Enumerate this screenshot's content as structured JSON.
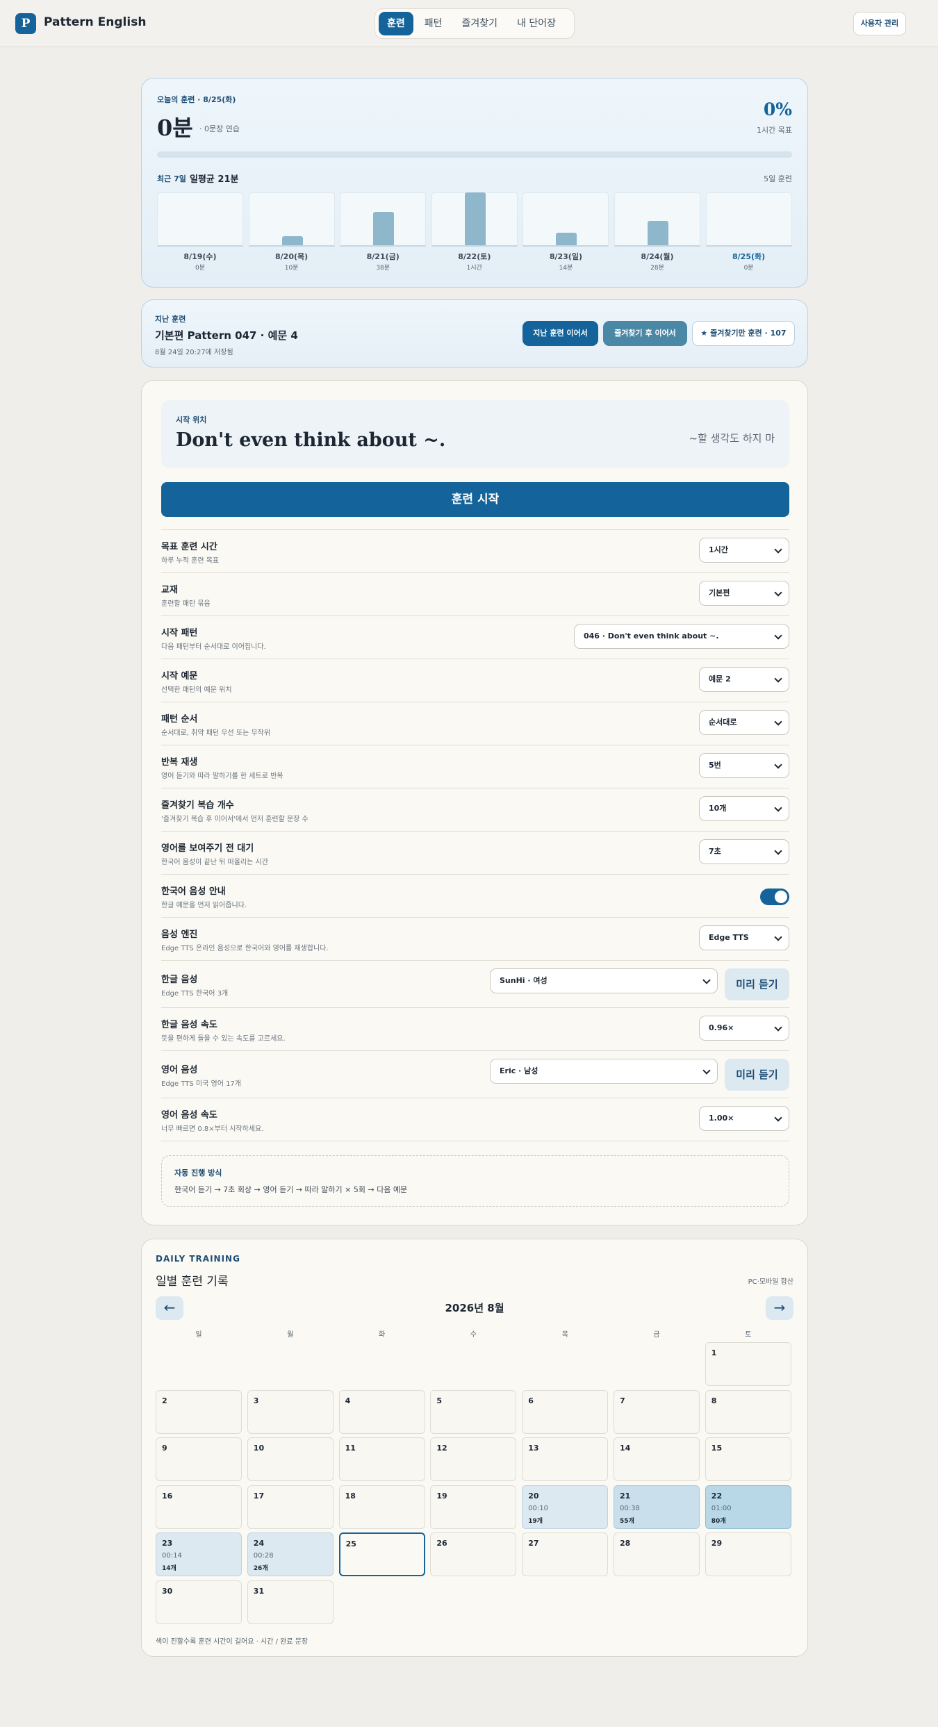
{
  "app": {
    "logo_letter": "P",
    "name": "Pattern English",
    "admin_label": "사용자 관리"
  },
  "nav": {
    "tabs": [
      "훈련",
      "패턴",
      "즐겨찾기",
      "내 단어장"
    ],
    "active_index": 0
  },
  "today": {
    "kicker": "오늘의 훈련 · 8/25(화)",
    "minutes": "0분",
    "sentences": "· 0문장 연습",
    "percent": "0%",
    "goal": "1시간 목표",
    "progress": 0,
    "week_label": "최근 7일",
    "week_avg": "일평균 21분",
    "week_days": "5일 훈련",
    "days": [
      {
        "date": "8/19(수)",
        "value": "0분",
        "minutes": 0
      },
      {
        "date": "8/20(목)",
        "value": "10분",
        "minutes": 10
      },
      {
        "date": "8/21(금)",
        "value": "38분",
        "minutes": 38
      },
      {
        "date": "8/22(토)",
        "value": "1시간",
        "minutes": 60
      },
      {
        "date": "8/23(일)",
        "value": "14분",
        "minutes": 14
      },
      {
        "date": "8/24(월)",
        "value": "28분",
        "minutes": 28
      },
      {
        "date": "8/25(화)",
        "value": "0분",
        "minutes": 0
      }
    ]
  },
  "resume": {
    "kicker": "지난 훈련",
    "title": "기본편 Pattern 047 · 예문 4",
    "saved": "8월 24일 20:27에 저장됨",
    "btn_continue": "지난 훈련 이어서",
    "btn_fav_continue": "즐겨찾기 후 이어서",
    "btn_fav_only": "★ 즐겨찾기만 훈련 · 107"
  },
  "settings": {
    "start_kicker": "시작 위치",
    "start_english": "Don't even think about ~.",
    "start_korean": "~할 생각도 하지 마",
    "start_button": "훈련 시작",
    "rows": [
      {
        "label": "목표 훈련 시간",
        "desc": "하루 누적 훈련 목표",
        "value": "1시간"
      },
      {
        "label": "교재",
        "desc": "훈련할 패턴 묶음",
        "value": "기본편"
      },
      {
        "label": "시작 패턴",
        "desc": "다음 패턴부터 순서대로 이어집니다.",
        "value": "046 · Don't even think about ~."
      },
      {
        "label": "시작 예문",
        "desc": "선택한 패턴의 예문 위치",
        "value": "예문 2"
      },
      {
        "label": "패턴 순서",
        "desc": "순서대로, 취약 패턴 우선 또는 무작위",
        "value": "순서대로"
      },
      {
        "label": "반복 재생",
        "desc": "영어 듣기와 따라 말하기를 한 세트로 반복",
        "value": "5번"
      },
      {
        "label": "즐겨찾기 복습 개수",
        "desc": "'즐겨찾기 복습 후 이어서'에서 먼저 훈련할 문장 수",
        "value": "10개"
      },
      {
        "label": "영어를 보여주기 전 대기",
        "desc": "한국어 음성이 끝난 뒤 떠올리는 시간",
        "value": "7초"
      },
      {
        "label": "한국어 음성 안내",
        "desc": "한글 예문을 먼저 읽어줍니다.",
        "toggle": true
      },
      {
        "label": "음성 엔진",
        "desc": "Edge TTS 온라인 음성으로 한국어와 영어를 재생합니다.",
        "value": "Edge TTS"
      },
      {
        "label": "한글 음성",
        "desc": "Edge TTS 한국어 3개",
        "value": "SunHi · 여성",
        "preview": "미리 듣기"
      },
      {
        "label": "한글 음성 속도",
        "desc": "뜻을 편하게 들을 수 있는 속도를 고르세요.",
        "value": "0.96×"
      },
      {
        "label": "영어 음성",
        "desc": "Edge TTS 미국 영어 17개",
        "value": "Eric · 남성",
        "preview": "미리 듣기"
      },
      {
        "label": "영어 음성 속도",
        "desc": "너무 빠르면 0.8×부터 시작하세요.",
        "value": "1.00×"
      }
    ],
    "auto_kicker": "자동 진행 방식",
    "auto_flow": "한국어 듣기 → 7초 회상 → 영어 듣기 → 따라 말하기 × 5회 → 다음 예문"
  },
  "calendar": {
    "kicker": "DAILY TRAINING",
    "title": "일별 훈련 기록",
    "sync": "PC·모바일 합산",
    "prev": "←",
    "next": "→",
    "month": "2026년 8월",
    "weekdays": [
      "일",
      "월",
      "화",
      "수",
      "목",
      "금",
      "토"
    ],
    "first_weekday": 6,
    "days_in_month": 31,
    "current_day": 25,
    "entries": {
      "20": {
        "time": "00:10",
        "count": "19개",
        "level": 1
      },
      "21": {
        "time": "00:38",
        "count": "55개",
        "level": 2
      },
      "22": {
        "time": "01:00",
        "count": "80개",
        "level": 3
      },
      "23": {
        "time": "00:14",
        "count": "14개",
        "level": 1
      },
      "24": {
        "time": "00:28",
        "count": "26개",
        "level": 1
      }
    },
    "note": "색이 진할수록 훈련 시간이 길어요 · 시간 / 완료 문장"
  }
}
